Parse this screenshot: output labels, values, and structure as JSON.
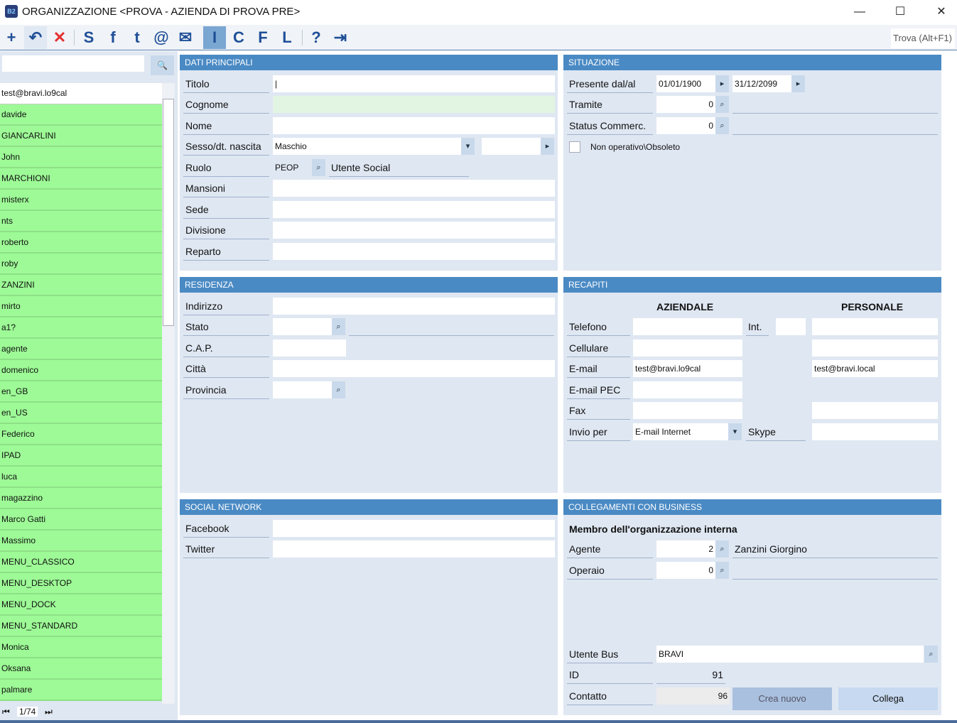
{
  "window": {
    "title": "ORGANIZZAZIONE <PROVA - AZIENDA DI PROVA PRE>",
    "app_icon": "B2",
    "minimize": "—",
    "maximize": "☐",
    "close": "✕"
  },
  "toolbar": {
    "find_label": "Trova (Alt+F1)",
    "buttons": {
      "add": "+",
      "undo": "↶",
      "delete": "✕",
      "skype": "S",
      "facebook": "f",
      "twitter": "t",
      "email": "@",
      "mail": "✉",
      "i": "I",
      "c": "C",
      "f": "F",
      "l": "L",
      "help": "?",
      "exit": "⇥"
    }
  },
  "sidebar": {
    "search_value": "",
    "search_icon": "🔍",
    "items": [
      "test@bravi.lo9cal",
      "davide",
      "GIANCARLINI",
      "John",
      "MARCHIONI",
      "misterx",
      "nts",
      "roberto",
      "roby",
      "ZANZINI",
      "mirto",
      "a1?",
      "agente",
      "domenico",
      "en_GB",
      "en_US",
      "Federico",
      "IPAD",
      "luca",
      "magazzino",
      "Marco Gatti",
      "Massimo",
      "MENU_CLASSICO",
      "MENU_DESKTOP",
      "MENU_DOCK",
      "MENU_STANDARD",
      "Monica",
      "Oksana",
      "palmare"
    ],
    "pager": "1/74"
  },
  "dati": {
    "title": "DATI PRINCIPALI",
    "titolo": "Titolo",
    "cognome": "Cognome",
    "nome": "Nome",
    "sesso": "Sesso/dt. nascita",
    "sesso_value": "Maschio",
    "ruolo": "Ruolo",
    "ruolo_code": "PEOP",
    "ruolo_desc": "Utente Social",
    "mansioni": "Mansioni",
    "sede": "Sede",
    "divisione": "Divisione",
    "reparto": "Reparto"
  },
  "situazione": {
    "title": "SITUAZIONE",
    "presente": "Presente dal/al",
    "dal": "01/01/1900",
    "al": "31/12/2099",
    "tramite": "Tramite",
    "tramite_value": "0",
    "status": "Status Commerc.",
    "status_value": "0",
    "obsoleto": "Non operativo\\Obsoleto"
  },
  "residenza": {
    "title": "RESIDENZA",
    "indirizzo": "Indirizzo",
    "stato": "Stato",
    "cap": "C.A.P.",
    "citta": "Città",
    "provincia": "Provincia"
  },
  "recapiti": {
    "title": "RECAPITI",
    "aziendale": "AZIENDALE",
    "personale": "PERSONALE",
    "telefono": "Telefono",
    "int": "Int.",
    "cellulare": "Cellulare",
    "email": "E-mail",
    "email_az": "test@bravi.lo9cal",
    "email_pers": "test@bravi.local",
    "pec": "E-mail PEC",
    "fax": "Fax",
    "invio": "Invio per",
    "invio_value": "E-mail Internet",
    "skype": "Skype"
  },
  "social": {
    "title": "SOCIAL NETWORK",
    "facebook": "Facebook",
    "twitter": "Twitter"
  },
  "business": {
    "title": "COLLEGAMENTI CON BUSINESS",
    "membro": "Membro dell'organizzazione interna",
    "agente": "Agente",
    "agente_value": "2",
    "agente_name": "Zanzini Giorgino",
    "operaio": "Operaio",
    "operaio_value": "0",
    "utente_bus": "Utente Bus",
    "utente_bus_value": "BRAVI",
    "id": "ID",
    "id_value": "91",
    "contatto": "Contatto",
    "contatto_value": "96",
    "crea": "Crea nuovo",
    "collega": "Collega"
  }
}
